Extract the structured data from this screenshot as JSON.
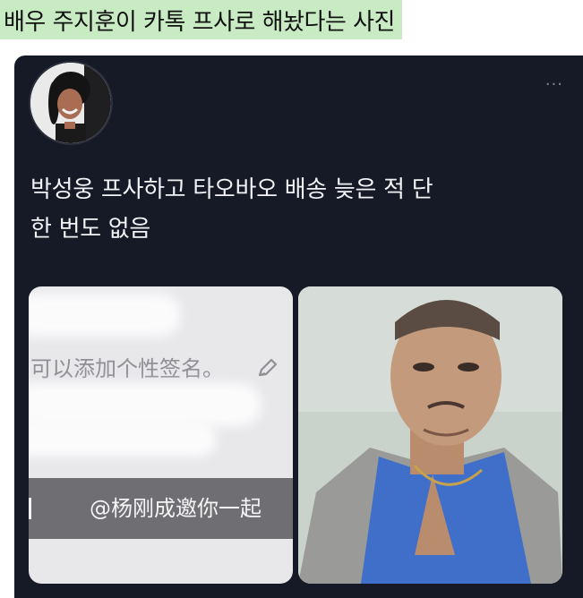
{
  "caption": {
    "text": "배우 주지훈이 카톡 프사로 해놨다는 사진"
  },
  "tweet": {
    "more_label": "···",
    "text_line1": "박성웅 프사하고 타오바오 배송 늦은 적 단",
    "text_line2": "한 번도 없음"
  },
  "media": {
    "left": {
      "signature_text": "可以添加个性签名。",
      "mention_text": "@杨刚成邀你一起"
    }
  },
  "icons": {
    "more": "more-horizontal-icon",
    "edit": "pencil-icon"
  },
  "colors": {
    "caption_bg": "#c8ebc4",
    "tweet_bg": "#151a26",
    "text": "#f2f3f5",
    "shirt": "#3f6fc9"
  }
}
